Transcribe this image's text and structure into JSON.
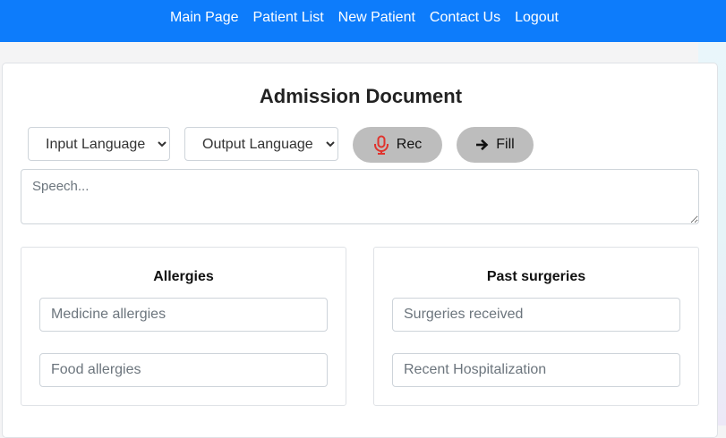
{
  "nav": {
    "items": [
      "Main Page",
      "Patient List",
      "New Patient",
      "Contact Us",
      "Logout"
    ]
  },
  "page": {
    "title": "Admission Document"
  },
  "controls": {
    "input_language": "Input Language",
    "output_language": "Output Language",
    "rec_label": "Rec",
    "fill_label": "Fill",
    "speech_placeholder": "Speech..."
  },
  "sections": {
    "allergies": {
      "title": "Allergies",
      "field1_placeholder": "Medicine allergies",
      "field2_placeholder": "Food allergies"
    },
    "past_surgeries": {
      "title": "Past surgeries",
      "field1_placeholder": "Surgeries received",
      "field2_placeholder": "Recent Hospitalization"
    }
  },
  "colors": {
    "navbar": "#0d7cfb",
    "mic_icon": "#e0332d",
    "pill_button": "#bdbdbd"
  },
  "icons": {
    "rec": "microphone-icon",
    "fill": "arrow-right-icon"
  }
}
